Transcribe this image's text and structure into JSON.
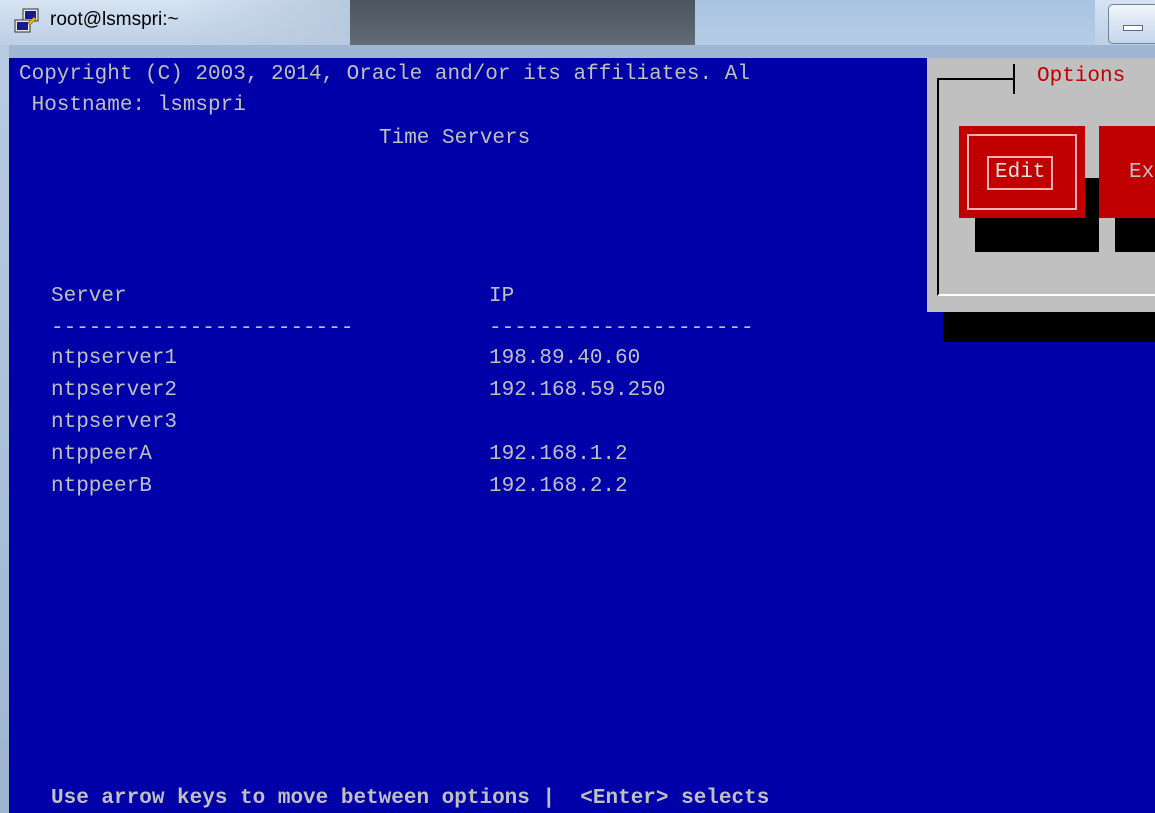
{
  "window": {
    "title": "root@lsmspri:~",
    "icon": "putty-icon"
  },
  "terminal": {
    "copyright": "Copyright (C) 2003, 2014, Oracle and/or its affiliates. Al",
    "hostname": " Hostname: lsmspri",
    "screen_title": "Time Servers",
    "table": {
      "headers": {
        "server": "Server",
        "ip": "IP"
      },
      "separators": {
        "server": "------------------------",
        "ip": "---------------------"
      },
      "rows": [
        {
          "server": "ntpserver1",
          "ip": "198.89.40.60"
        },
        {
          "server": "ntpserver2",
          "ip": "192.168.59.250"
        },
        {
          "server": "ntpserver3",
          "ip": ""
        },
        {
          "server": "ntppeerA",
          "ip": "192.168.1.2"
        },
        {
          "server": "ntppeerB",
          "ip": "192.168.2.2"
        }
      ]
    },
    "help_line": "Use arrow keys to move between options |  <Enter> selects"
  },
  "options_dialog": {
    "title": "Options",
    "buttons": [
      {
        "label": "Edit"
      },
      {
        "label": "Ex"
      }
    ]
  },
  "colors": {
    "terminal_bg": "#0000a8",
    "terminal_fg": "#c0c0c0",
    "dialog_bg": "#c0c0c0",
    "button_bg": "#c00000",
    "dialog_title": "#c00000"
  }
}
